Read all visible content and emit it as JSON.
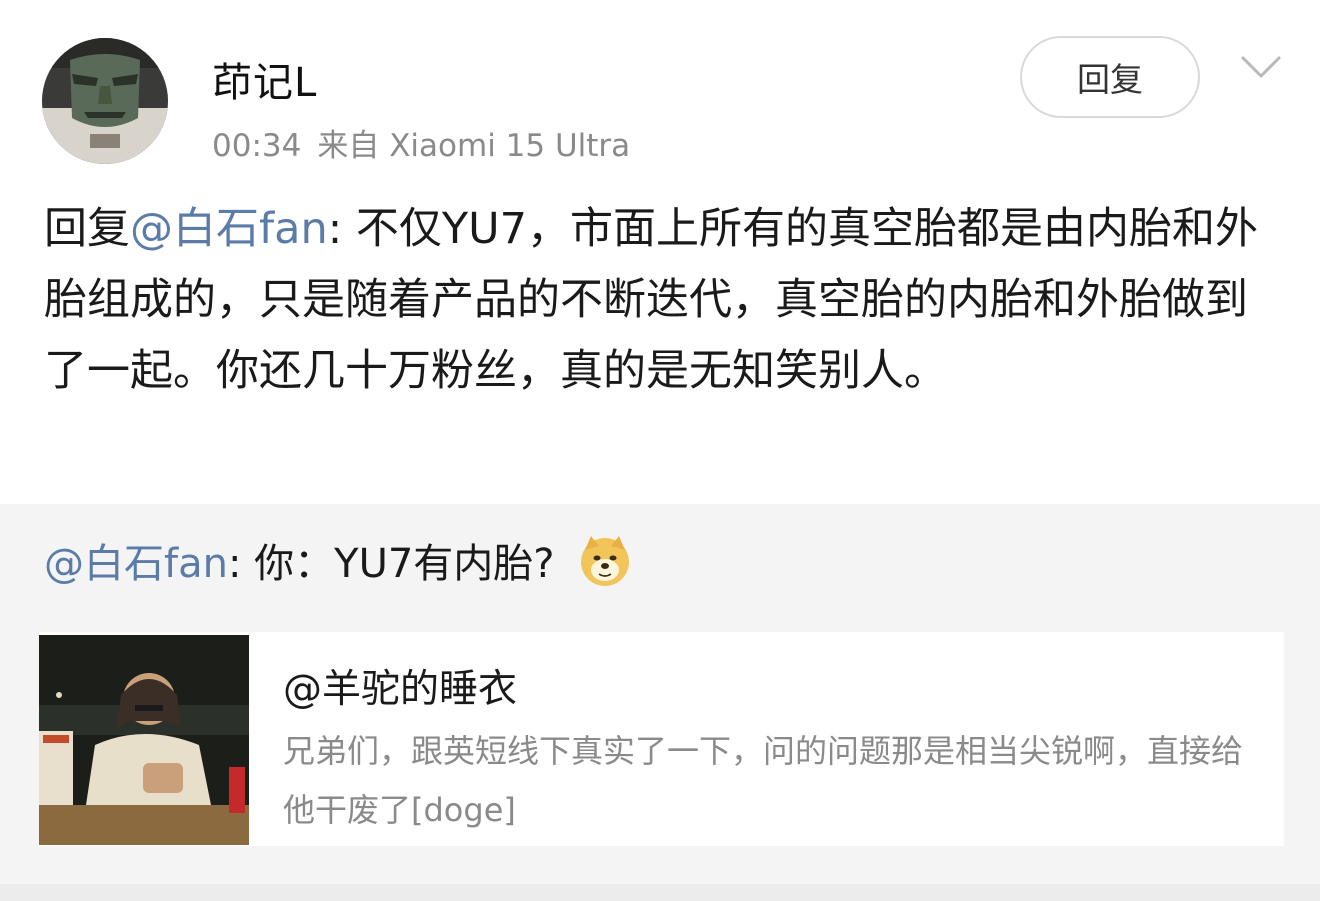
{
  "post": {
    "username": "茚记L",
    "time": "00:34",
    "source": "来自 Xiaomi 15 Ultra",
    "reply_button": "回复",
    "content": {
      "prefix": "回复",
      "mention": "@白石fan",
      "text": ": 不仅YU7，市面上所有的真空胎都是由内胎和外胎组成的，只是随着产品的不断迭代，真空胎的内胎和外胎做到了一起。你还几十万粉丝，真的是无知笑别人。"
    }
  },
  "quoted": {
    "mention": "@白石fan",
    "text": ": 你：YU7有内胎?",
    "emoji": "doge-icon",
    "card": {
      "title": "@羊驼的睡衣",
      "description": "兄弟们，跟英短线下真实了一下，问的问题那是相当尖锐啊，直接给他干废了[doge]"
    }
  },
  "colors": {
    "mention": "#5b7ca9",
    "meta": "#8a8a8a",
    "quote_bg": "#f4f4f4"
  }
}
